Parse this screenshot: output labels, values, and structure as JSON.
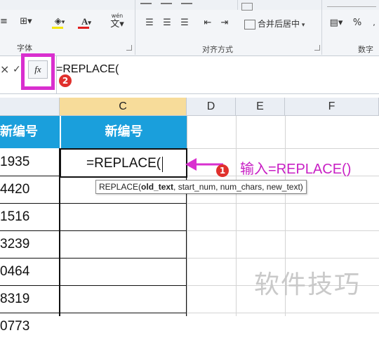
{
  "ribbon": {
    "font_group_title": "字体",
    "alignment_group_title": "对齐方式",
    "number_group_title": "数字",
    "wen_glyph": "wén",
    "merge_center_label": "合并后居中",
    "currency_label": "%"
  },
  "formula_bar": {
    "fx_label": "fx",
    "formula_text": "=REPLACE(",
    "cancel_glyph": "×",
    "enter_glyph": "✓",
    "badge_number": "2"
  },
  "columns": [
    "C",
    "D",
    "E",
    "F"
  ],
  "table": {
    "left_header": "新编号",
    "c_header": "新编号",
    "left_values": [
      "1935",
      "4420",
      "1516",
      "3239",
      "0464",
      "8319",
      "0773"
    ]
  },
  "active_cell": {
    "text": "=REPLACE("
  },
  "tooltip": {
    "func": "REPLACE(",
    "arg_bold": "old_text",
    "rest": ", start_num, num_chars, new_text)"
  },
  "annotation": {
    "badge_number": "1",
    "text": "输入=REPLACE()"
  },
  "watermark": "软件技巧",
  "colors": {
    "header_fill": "#1a9fdc",
    "highlight_magenta": "#d92fcf",
    "badge_red": "#e0302c",
    "annotation_text": "#c81fc4",
    "selected_col": "#f7dc9a"
  }
}
